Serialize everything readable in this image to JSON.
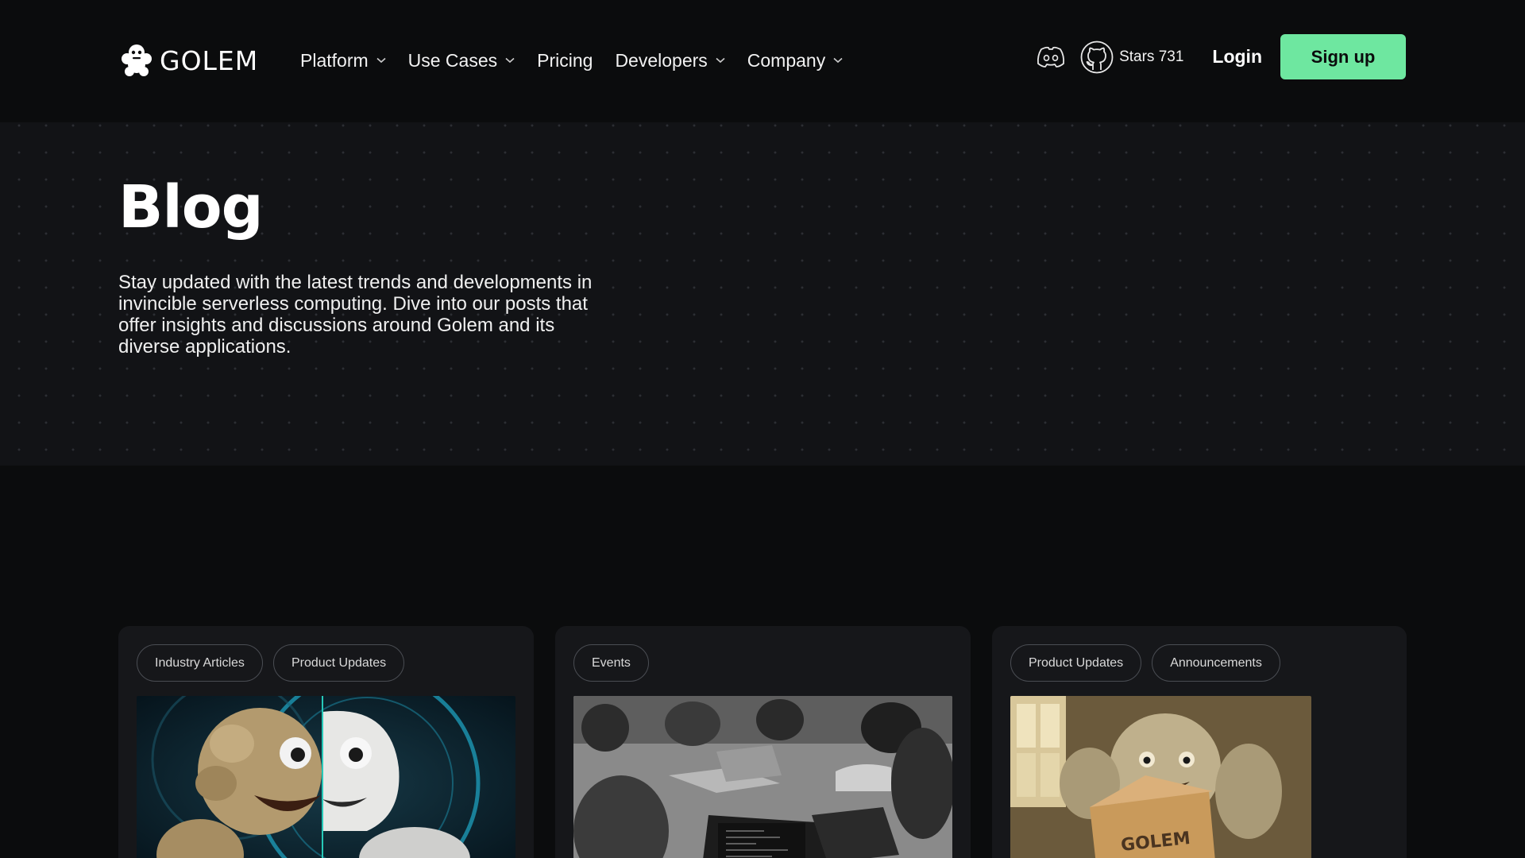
{
  "brand": {
    "name": "GOLEM"
  },
  "nav": {
    "items": [
      {
        "label": "Platform",
        "has_dropdown": true
      },
      {
        "label": "Use Cases",
        "has_dropdown": true
      },
      {
        "label": "Pricing",
        "has_dropdown": false
      },
      {
        "label": "Developers",
        "has_dropdown": true
      },
      {
        "label": "Company",
        "has_dropdown": true
      }
    ],
    "stars_label": "Stars 731",
    "login_label": "Login",
    "signup_label": "Sign up",
    "icons": [
      "discord-icon",
      "github-icon"
    ]
  },
  "hero": {
    "title": "Blog",
    "description": "Stay updated with the latest trends and developments in invincible serverless computing. Dive into our posts that offer insights and discussions around Golem and its diverse applications."
  },
  "cards": [
    {
      "tags": [
        "Industry Articles",
        "Product Updates"
      ],
      "image": "golem-vs-robot-illustration"
    },
    {
      "tags": [
        "Events"
      ],
      "image": "hackathon-photo-bw"
    },
    {
      "tags": [
        "Product Updates",
        "Announcements"
      ],
      "image": "golem-box-illustration"
    }
  ],
  "colors": {
    "accent": "#6ee7a0",
    "background": "#0b0c0d",
    "hero_bg": "#121316",
    "card_bg": "#16171a"
  }
}
